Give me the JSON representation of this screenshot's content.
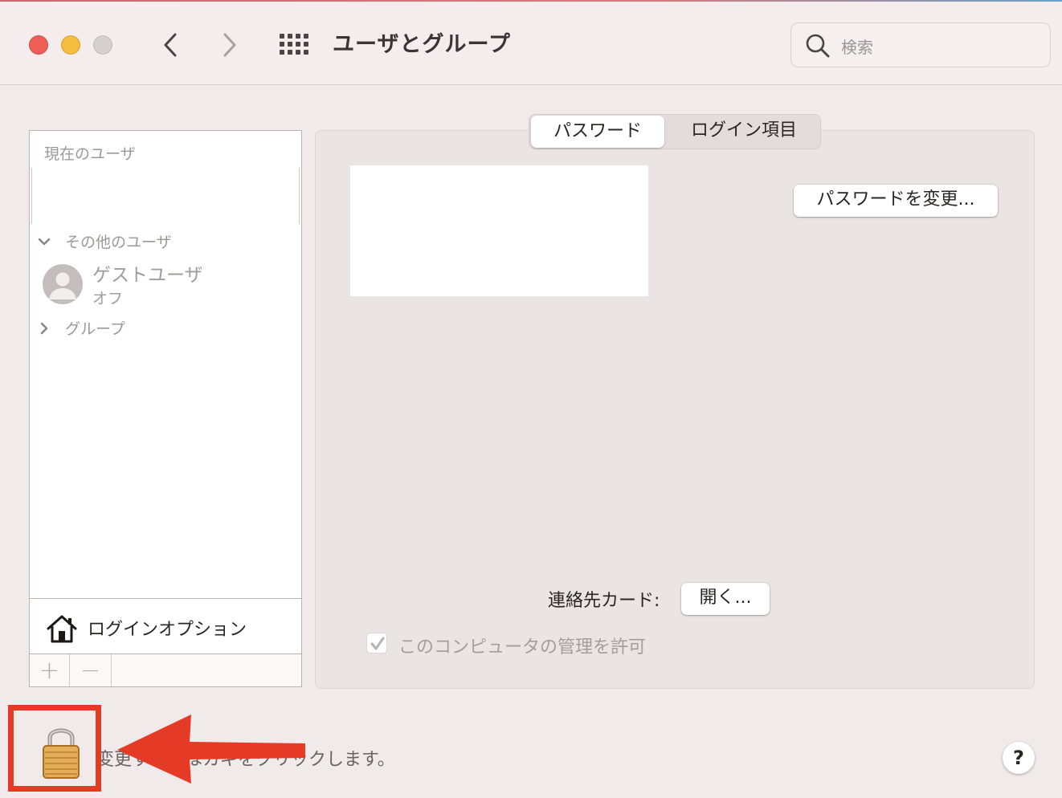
{
  "window": {
    "title": "ユーザとグループ"
  },
  "toolbar": {
    "search_placeholder": "検索"
  },
  "sidebar": {
    "current_users_label": "現在のユーザ",
    "other_users_label": "その他のユーザ",
    "guest_user": {
      "name": "ゲストユーザ",
      "status": "オフ"
    },
    "groups_label": "グループ",
    "login_options_label": "ログインオプション",
    "add_label": "+",
    "remove_label": "−"
  },
  "tabs": [
    {
      "label": "パスワード",
      "selected": true
    },
    {
      "label": "ログイン項目",
      "selected": false
    }
  ],
  "main": {
    "change_password_label": "パスワードを変更...",
    "contact_card_label": "連絡先カード:",
    "open_button_label": "開く...",
    "admin_checkbox_label": "このコンピュータの管理を許可",
    "admin_checked": true
  },
  "footer": {
    "lock_message": "変更するにはカギをクリックします。",
    "help_label": "?"
  },
  "colors": {
    "highlight": "#e53a26",
    "traffic_red": "#ee5f57",
    "traffic_yellow": "#f5bd3f"
  },
  "icons": [
    "close-icon",
    "minimize-icon",
    "zoom-icon",
    "chevron-left-icon",
    "chevron-right-icon",
    "grid-icon",
    "search-icon",
    "chevron-down-icon",
    "chevron-right-icon",
    "user-avatar-icon",
    "home-icon",
    "lock-icon",
    "arrow-icon",
    "help-icon"
  ]
}
